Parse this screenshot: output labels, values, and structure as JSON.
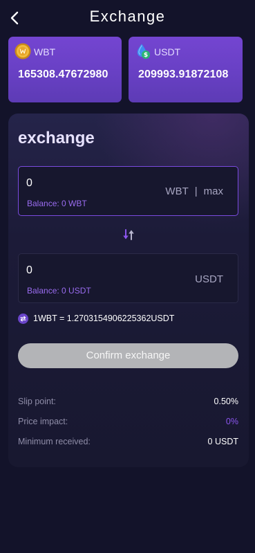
{
  "header": {
    "title": "Exchange",
    "back_icon": "chevron-left-icon"
  },
  "tokens": {
    "wbt": {
      "symbol": "WBT",
      "balance": "165308.47672980",
      "icon": "wbt-coin-icon"
    },
    "usdt": {
      "symbol": "USDT",
      "balance": "209993.91872108",
      "icon": "usdt-drop-icon"
    }
  },
  "exchange": {
    "title": "exchange",
    "from": {
      "value": "0",
      "balance_label": "Balance: 0 WBT",
      "symbol": "WBT",
      "separator": "|",
      "max_label": "max"
    },
    "to": {
      "value": "0",
      "balance_label": "Balance: 0 USDT",
      "symbol": "USDT"
    },
    "swap_icon": "swap-arrows-icon",
    "rate_icon": "exchange-rate-icon",
    "rate_text": "1WBT = 1.2703154906225362USDT",
    "confirm_label": "Confirm exchange",
    "info": {
      "slip_label": "Slip point:",
      "slip_value": "0.50%",
      "impact_label": "Price impact:",
      "impact_value": "0%",
      "min_label": "Minimum received:",
      "min_value": "0 USDT"
    }
  },
  "colors": {
    "background": "#13132a",
    "card_purple": "#6d42cc",
    "accent": "#8b55ee",
    "button_disabled": "#b3b4b7"
  }
}
